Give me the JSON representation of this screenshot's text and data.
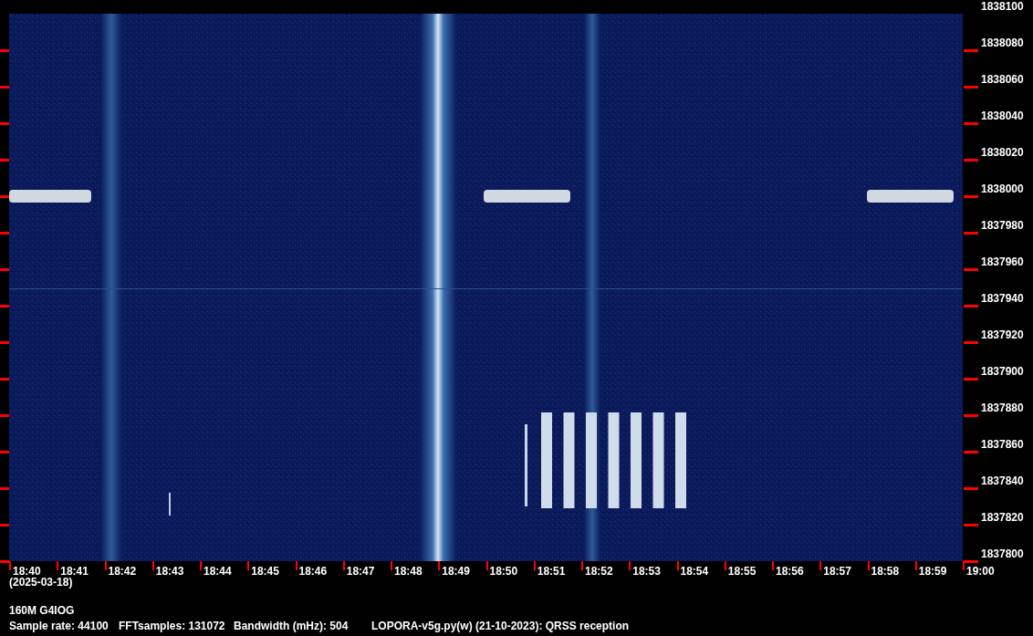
{
  "frequency_axis": {
    "labels": [
      "1838100",
      "1838080",
      "1838060",
      "1838040",
      "1838020",
      "1838000",
      "1837980",
      "1837960",
      "1837940",
      "1837920",
      "1837900",
      "1837880",
      "1837860",
      "1837840",
      "1837820",
      "1837800"
    ]
  },
  "time_axis": {
    "labels": [
      "18:40",
      "18:41",
      "18:42",
      "18:43",
      "18:44",
      "18:45",
      "18:46",
      "18:47",
      "18:48",
      "18:49",
      "18:50",
      "18:51",
      "18:52",
      "18:53",
      "18:54",
      "18:55",
      "18:56",
      "18:57",
      "18:58",
      "18:59",
      "19:00"
    ],
    "date": "(2025-03-18)"
  },
  "station": "160M G4IOG",
  "status_bar": {
    "sample_rate": "Sample rate: 44100",
    "fft_samples": "FFTsamples: 131072",
    "bandwidth": "Bandwidth (mHz): 504",
    "program": "LOPORA-v5g.py(w) (21-10-2023): QRSS reception"
  }
}
